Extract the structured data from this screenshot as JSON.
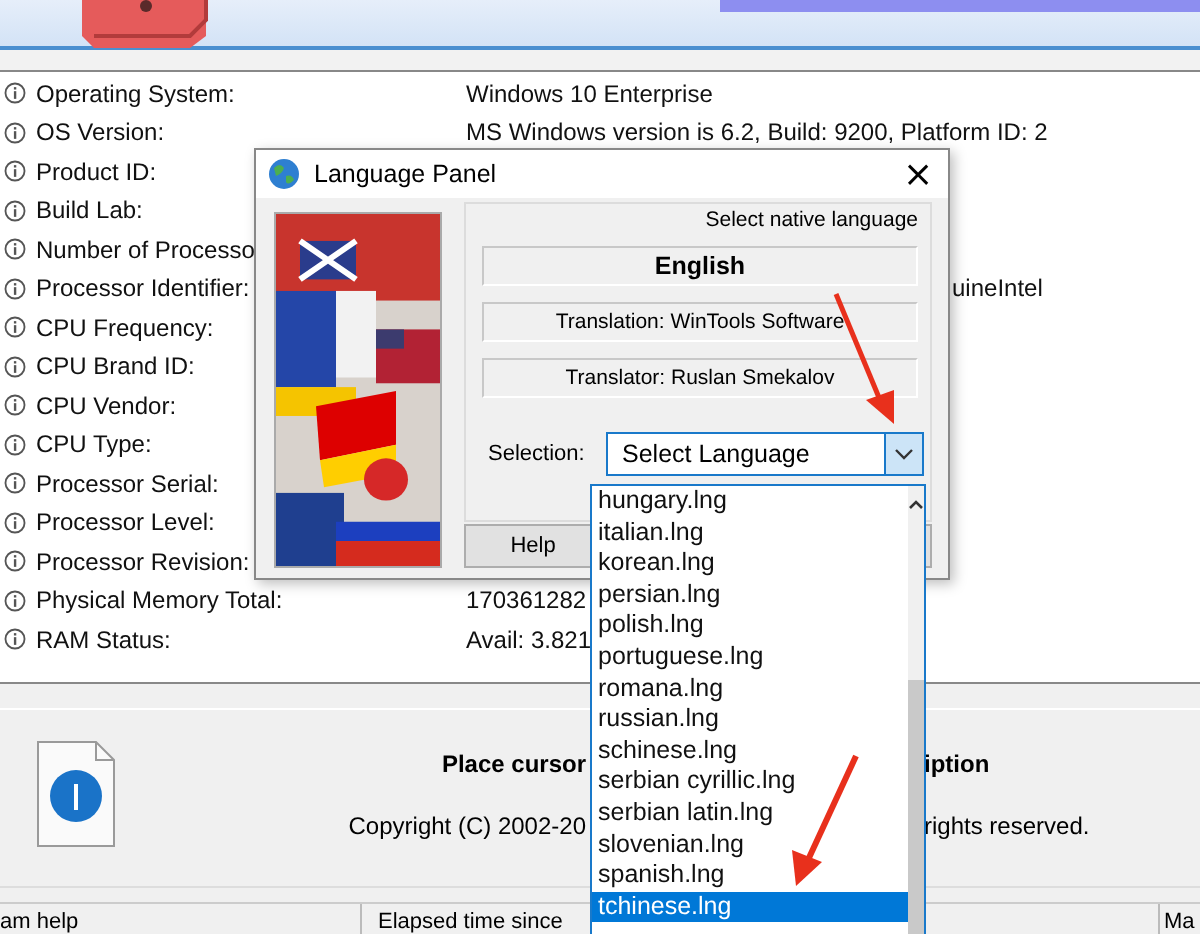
{
  "properties": [
    {
      "label": "Operating System:",
      "value": "Windows 10 Enterprise"
    },
    {
      "label": "OS Version:",
      "value": "MS Windows version is 6.2, Build: 9200, Platform ID: 2"
    },
    {
      "label": "Product ID:"
    },
    {
      "label": "Build Lab:"
    },
    {
      "label": "Number of Processo"
    },
    {
      "label": "Processor Identifier:",
      "value": "uineIntel",
      "value_clipped": true
    },
    {
      "label": "CPU Frequency:"
    },
    {
      "label": "CPU Brand ID:"
    },
    {
      "label": "CPU Vendor:"
    },
    {
      "label": "CPU Type:"
    },
    {
      "label": "Processor Serial:"
    },
    {
      "label": "Processor Level:"
    },
    {
      "label": "Processor Revision:"
    },
    {
      "label": "Physical Memory Total:",
      "value": "170361282"
    },
    {
      "label": "RAM Status:",
      "value": "Avail: 3.821"
    }
  ],
  "dialog": {
    "title": "Language Panel",
    "close": "×",
    "group_label": "Select native language",
    "language": "English",
    "translation": "Translation: WinTools Software",
    "translator": "Translator: Ruslan Smekalov",
    "selection_label": "Selection:",
    "combo_value": "Select Language",
    "buttons": [
      "Help"
    ],
    "list": [
      {
        "label": "hungary.lng",
        "selected": false
      },
      {
        "label": "italian.lng",
        "selected": false
      },
      {
        "label": "korean.lng",
        "selected": false
      },
      {
        "label": "persian.lng",
        "selected": false
      },
      {
        "label": "polish.lng",
        "selected": false
      },
      {
        "label": "portuguese.lng",
        "selected": false
      },
      {
        "label": "romana.lng",
        "selected": false
      },
      {
        "label": "russian.lng",
        "selected": false
      },
      {
        "label": "schinese.lng",
        "selected": false
      },
      {
        "label": "serbian cyrillic.lng",
        "selected": false
      },
      {
        "label": "serbian latin.lng",
        "selected": false
      },
      {
        "label": "slovenian.lng",
        "selected": false
      },
      {
        "label": "spanish.lng",
        "selected": false
      },
      {
        "label": "tchinese.lng",
        "selected": true
      }
    ]
  },
  "description": {
    "title_left": "Place cursor",
    "title_right": "iption",
    "copyright_left": "Copyright (C) 2002-20",
    "copyright_right": "rights reserved."
  },
  "status_bar": [
    "am help",
    "Elapsed time since",
    "Ma"
  ]
}
